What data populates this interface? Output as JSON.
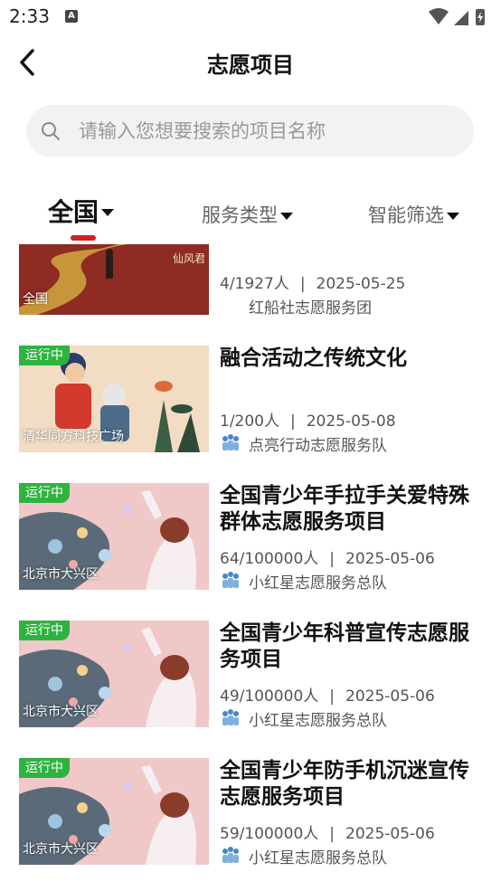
{
  "status_bar": {
    "time": "2:33",
    "notif_glyph": "A"
  },
  "header": {
    "title": "志愿项目"
  },
  "search": {
    "placeholder": "请输入您想要搜索的项目名称"
  },
  "filters": [
    {
      "label": "全国",
      "active": true
    },
    {
      "label": "服务类型",
      "active": false
    },
    {
      "label": "智能筛选",
      "active": false
    }
  ],
  "projects": [
    {
      "title": "",
      "badge": "",
      "location": "全国",
      "participants": "4/1927人",
      "date": "2025-05-25",
      "org": "红船社志愿服务团",
      "thumb_text": "仙风君"
    },
    {
      "title": "融合活动之传统文化",
      "badge": "运行中",
      "location": "清华同方科技广场",
      "participants": "1/200人",
      "date": "2025-05-08",
      "org": "点亮行动志愿服务队"
    },
    {
      "title": "全国青少年手拉手关爱特殊群体志愿服务项目",
      "badge": "运行中",
      "location": "北京市大兴区",
      "participants": "64/100000人",
      "date": "2025-05-06",
      "org": "小红星志愿服务总队"
    },
    {
      "title": "全国青少年科普宣传志愿服务项目",
      "badge": "运行中",
      "location": "北京市大兴区",
      "participants": "49/100000人",
      "date": "2025-05-06",
      "org": "小红星志愿服务总队"
    },
    {
      "title": "全国青少年防手机沉迷宣传志愿服务项目",
      "badge": "运行中",
      "location": "北京市大兴区",
      "participants": "59/100000人",
      "date": "2025-05-06",
      "org": "小红星志愿服务总队"
    }
  ],
  "colors": {
    "accent": "#d61f1f",
    "badge": "#2fb33f",
    "search_bg": "#f2f2f2"
  }
}
